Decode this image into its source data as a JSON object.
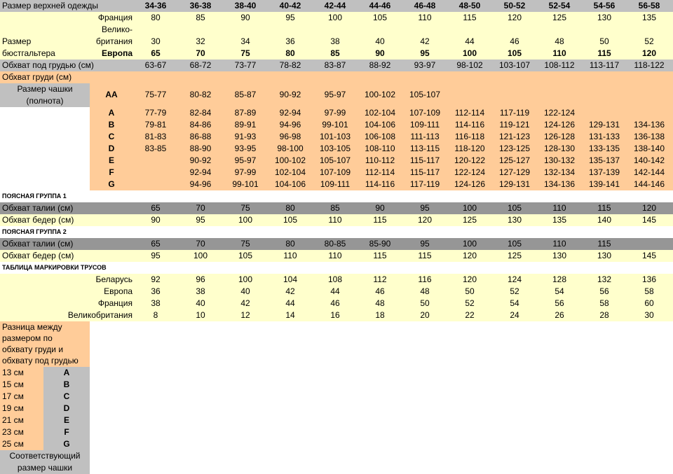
{
  "sizes": {
    "label": "Размер верхней одежды",
    "values": [
      "34-36",
      "36-38",
      "38-40",
      "40-42",
      "42-44",
      "44-46",
      "46-48",
      "48-50",
      "50-52",
      "52-54",
      "54-56",
      "56-58"
    ]
  },
  "france": {
    "label": "Франция",
    "values": [
      "80",
      "85",
      "90",
      "95",
      "100",
      "105",
      "110",
      "115",
      "120",
      "125",
      "130",
      "135"
    ]
  },
  "uk": {
    "label1": "Велико-",
    "label2": "британия",
    "values": [
      "30",
      "32",
      "34",
      "36",
      "38",
      "40",
      "42",
      "44",
      "46",
      "48",
      "50",
      "52"
    ]
  },
  "bra": {
    "label1": "Размер",
    "label2": "бюстгальтера"
  },
  "europe": {
    "label": "Европа",
    "values": [
      "65",
      "70",
      "75",
      "80",
      "85",
      "90",
      "95",
      "100",
      "105",
      "110",
      "115",
      "120"
    ]
  },
  "underbust": {
    "label": "Обхват под грудью (см)",
    "values": [
      "63-67",
      "68-72",
      "73-77",
      "78-82",
      "83-87",
      "88-92",
      "93-97",
      "98-102",
      "103-107",
      "108-112",
      "113-117",
      "118-122"
    ]
  },
  "bust": {
    "label": "Обхват груди (см)"
  },
  "cup_label": {
    "line1": "Размер чашки",
    "line2": "(полнота)"
  },
  "cups": [
    {
      "letter": "AA",
      "values": [
        "75-77",
        "80-82",
        "85-87",
        "90-92",
        "95-97",
        "100-102",
        "105-107",
        "",
        "",
        "",
        "",
        ""
      ]
    },
    {
      "letter": "A",
      "values": [
        "77-79",
        "82-84",
        "87-89",
        "92-94",
        "97-99",
        "102-104",
        "107-109",
        "112-114",
        "117-119",
        "122-124",
        "",
        ""
      ]
    },
    {
      "letter": "B",
      "values": [
        "79-81",
        "84-86",
        "89-91",
        "94-96",
        "99-101",
        "104-106",
        "109-111",
        "114-116",
        "119-121",
        "124-126",
        "129-131",
        "134-136"
      ]
    },
    {
      "letter": "C",
      "values": [
        "81-83",
        "86-88",
        "91-93",
        "96-98",
        "101-103",
        "106-108",
        "111-113",
        "116-118",
        "121-123",
        "126-128",
        "131-133",
        "136-138"
      ]
    },
    {
      "letter": "D",
      "values": [
        "83-85",
        "88-90",
        "93-95",
        "98-100",
        "103-105",
        "108-110",
        "113-115",
        "118-120",
        "123-125",
        "128-130",
        "133-135",
        "138-140"
      ]
    },
    {
      "letter": "E",
      "values": [
        "",
        "90-92",
        "95-97",
        "100-102",
        "105-107",
        "110-112",
        "115-117",
        "120-122",
        "125-127",
        "130-132",
        "135-137",
        "140-142"
      ]
    },
    {
      "letter": "F",
      "values": [
        "",
        "92-94",
        "97-99",
        "102-104",
        "107-109",
        "112-114",
        "115-117",
        "122-124",
        "127-129",
        "132-134",
        "137-139",
        "142-144"
      ]
    },
    {
      "letter": "G",
      "values": [
        "",
        "94-96",
        "99-101",
        "104-106",
        "109-111",
        "114-116",
        "117-119",
        "124-126",
        "129-131",
        "134-136",
        "139-141",
        "144-146"
      ]
    }
  ],
  "waist_group1": {
    "title": "ПОЯСНАЯ ГРУППА 1",
    "waist": {
      "label": "Обхват талии (см)",
      "values": [
        "65",
        "70",
        "75",
        "80",
        "85",
        "90",
        "95",
        "100",
        "105",
        "110",
        "115",
        "120"
      ]
    },
    "hips": {
      "label": "Обхват бедер (см)",
      "values": [
        "90",
        "95",
        "100",
        "105",
        "110",
        "115",
        "120",
        "125",
        "130",
        "135",
        "140",
        "145"
      ]
    }
  },
  "waist_group2": {
    "title": "ПОЯСНАЯ ГРУППА 2",
    "waist": {
      "label": "Обхват талии (см)",
      "values": [
        "65",
        "70",
        "75",
        "80",
        "80-85",
        "85-90",
        "95",
        "100",
        "105",
        "110",
        "115",
        ""
      ]
    },
    "hips": {
      "label": "Обхват бедер (см)",
      "values": [
        "95",
        "100",
        "105",
        "110",
        "110",
        "115",
        "115",
        "120",
        "125",
        "130",
        "130",
        "145"
      ]
    }
  },
  "panties": {
    "title": "ТАБЛИЦА МАРКИРОВКИ ТРУСОВ",
    "rows": [
      {
        "label": "Беларусь",
        "values": [
          "92",
          "96",
          "100",
          "104",
          "108",
          "112",
          "116",
          "120",
          "124",
          "128",
          "132",
          "136"
        ]
      },
      {
        "label": "Европа",
        "values": [
          "36",
          "38",
          "40",
          "42",
          "44",
          "46",
          "48",
          "50",
          "52",
          "54",
          "56",
          "58"
        ]
      },
      {
        "label": "Франция",
        "values": [
          "38",
          "40",
          "42",
          "44",
          "46",
          "48",
          "50",
          "52",
          "54",
          "56",
          "58",
          "60"
        ]
      },
      {
        "label": "Великобритания",
        "values": [
          "8",
          "10",
          "12",
          "14",
          "16",
          "18",
          "20",
          "22",
          "24",
          "26",
          "28",
          "30"
        ]
      }
    ]
  },
  "difference": {
    "title_lines": [
      "Разница между",
      "размером по",
      "обхвату груди и",
      "обхвату под грудью"
    ],
    "rows": [
      {
        "cm": "13 см",
        "cup": "A"
      },
      {
        "cm": "15 см",
        "cup": "B"
      },
      {
        "cm": "17 см",
        "cup": "C"
      },
      {
        "cm": "19 см",
        "cup": "D"
      },
      {
        "cm": "21 см",
        "cup": "E"
      },
      {
        "cm": "23 см",
        "cup": "F"
      },
      {
        "cm": "25 см",
        "cup": "G"
      }
    ],
    "footer_lines": [
      "Соответствующий",
      "размер чашки"
    ]
  },
  "colors": {
    "gray": "#c0c0c0",
    "dark_gray": "#969696",
    "yellow": "#ffffcc",
    "orange": "#ffcc99"
  }
}
